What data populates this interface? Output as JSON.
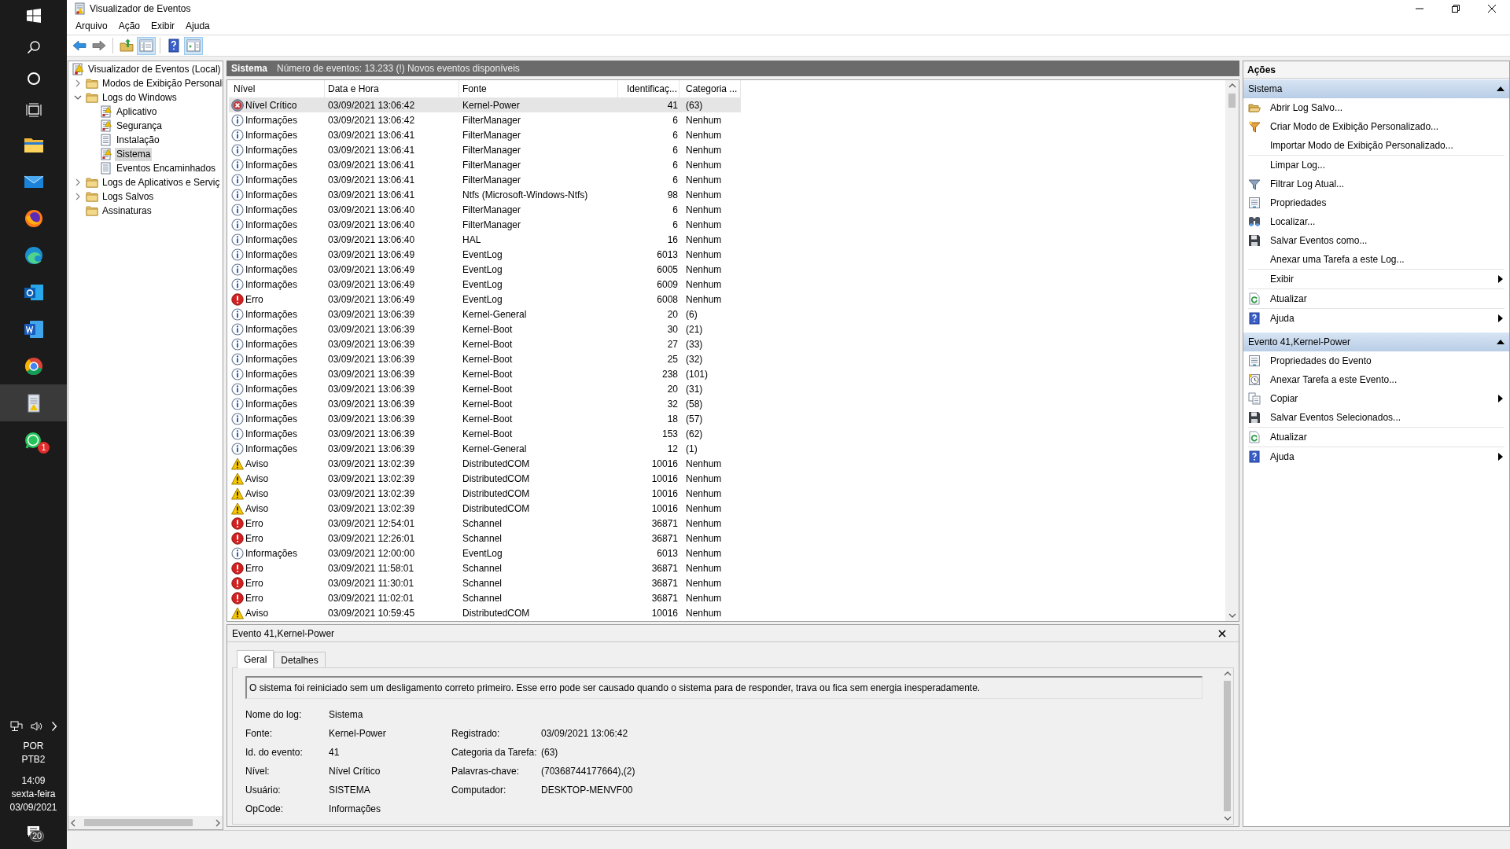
{
  "window": {
    "title": "Visualizador de Eventos"
  },
  "taskbar": {
    "apps": [
      {
        "kind": "folder",
        "selected": false
      },
      {
        "kind": "envelope",
        "selected": false
      },
      {
        "kind": "fox",
        "selected": false
      },
      {
        "kind": "wave",
        "selected": false
      },
      {
        "kind": "envelope-doc",
        "selected": false
      },
      {
        "kind": "doc",
        "selected": false
      },
      {
        "kind": "ring",
        "selected": false
      },
      {
        "kind": "log",
        "selected": true
      },
      {
        "kind": "chat",
        "selected": false,
        "badge": "1"
      }
    ],
    "tray": {
      "language": "POR",
      "layout": "PTB2",
      "time": "14:09",
      "weekday": "sexta-feira",
      "date": "03/09/2021",
      "notifications": "20"
    }
  },
  "menu": [
    "Arquivo",
    "Ação",
    "Exibir",
    "Ajuda"
  ],
  "toolbar": [
    [
      {
        "kind": "back",
        "pressed": false
      },
      {
        "kind": "forward",
        "pressed": false
      }
    ],
    [
      {
        "kind": "up",
        "pressed": false
      },
      {
        "kind": "tree",
        "pressed": true
      }
    ],
    [
      {
        "kind": "help",
        "pressed": false
      },
      {
        "kind": "actions",
        "pressed": true
      }
    ]
  ],
  "tree": [
    {
      "label": "Visualizador de Eventos (Local)",
      "kind": "viewer",
      "selected": false,
      "children": [
        {
          "label": "Modos de Exibição Personali",
          "kind": "folder",
          "selected": false,
          "expanded": false
        },
        {
          "label": "Logs do Windows",
          "kind": "folder",
          "selected": false,
          "expanded": true,
          "children": [
            {
              "label": "Aplicativo",
              "kind": "log-alert",
              "selected": false
            },
            {
              "label": "Segurança",
              "kind": "log-alert",
              "selected": false
            },
            {
              "label": "Instalação",
              "kind": "log",
              "selected": false
            },
            {
              "label": "Sistema",
              "kind": "log-alert",
              "selected": true
            },
            {
              "label": "Eventos Encaminhados",
              "kind": "log",
              "selected": false
            }
          ]
        },
        {
          "label": "Logs de Aplicativos e Serviç",
          "kind": "folder",
          "selected": false,
          "expanded": false
        },
        {
          "label": "Logs Salvos",
          "kind": "folder",
          "selected": false,
          "expanded": false
        },
        {
          "label": "Assinaturas",
          "kind": "folder",
          "selected": false
        }
      ]
    }
  ],
  "log_header": {
    "title": "Sistema",
    "message": "Número de eventos: 13.233 (!) Novos eventos disponíveis"
  },
  "table": {
    "columns": [
      "Nível",
      "Data e Hora",
      "Fonte",
      "Identificaç...",
      "Categoria ..."
    ],
    "rows": [
      {
        "kind": "critical",
        "level": "Nível Crítico",
        "date": "03/09/2021 13:06:42",
        "source": "Kernel-Power",
        "id": "41",
        "category": "(63)",
        "selected": true
      },
      {
        "kind": "info",
        "level": "Informações",
        "date": "03/09/2021 13:06:42",
        "source": "FilterManager",
        "id": "6",
        "category": "Nenhum",
        "selected": false
      },
      {
        "kind": "info",
        "level": "Informações",
        "date": "03/09/2021 13:06:41",
        "source": "FilterManager",
        "id": "6",
        "category": "Nenhum",
        "selected": false
      },
      {
        "kind": "info",
        "level": "Informações",
        "date": "03/09/2021 13:06:41",
        "source": "FilterManager",
        "id": "6",
        "category": "Nenhum",
        "selected": false
      },
      {
        "kind": "info",
        "level": "Informações",
        "date": "03/09/2021 13:06:41",
        "source": "FilterManager",
        "id": "6",
        "category": "Nenhum",
        "selected": false
      },
      {
        "kind": "info",
        "level": "Informações",
        "date": "03/09/2021 13:06:41",
        "source": "FilterManager",
        "id": "6",
        "category": "Nenhum",
        "selected": false
      },
      {
        "kind": "info",
        "level": "Informações",
        "date": "03/09/2021 13:06:41",
        "source": "Ntfs (Microsoft-Windows-Ntfs)",
        "id": "98",
        "category": "Nenhum",
        "selected": false
      },
      {
        "kind": "info",
        "level": "Informações",
        "date": "03/09/2021 13:06:40",
        "source": "FilterManager",
        "id": "6",
        "category": "Nenhum",
        "selected": false
      },
      {
        "kind": "info",
        "level": "Informações",
        "date": "03/09/2021 13:06:40",
        "source": "FilterManager",
        "id": "6",
        "category": "Nenhum",
        "selected": false
      },
      {
        "kind": "info",
        "level": "Informações",
        "date": "03/09/2021 13:06:40",
        "source": "HAL",
        "id": "16",
        "category": "Nenhum",
        "selected": false
      },
      {
        "kind": "info",
        "level": "Informações",
        "date": "03/09/2021 13:06:49",
        "source": "EventLog",
        "id": "6013",
        "category": "Nenhum",
        "selected": false
      },
      {
        "kind": "info",
        "level": "Informações",
        "date": "03/09/2021 13:06:49",
        "source": "EventLog",
        "id": "6005",
        "category": "Nenhum",
        "selected": false
      },
      {
        "kind": "info",
        "level": "Informações",
        "date": "03/09/2021 13:06:49",
        "source": "EventLog",
        "id": "6009",
        "category": "Nenhum",
        "selected": false
      },
      {
        "kind": "error",
        "level": "Erro",
        "date": "03/09/2021 13:06:49",
        "source": "EventLog",
        "id": "6008",
        "category": "Nenhum",
        "selected": false
      },
      {
        "kind": "info",
        "level": "Informações",
        "date": "03/09/2021 13:06:39",
        "source": "Kernel-General",
        "id": "20",
        "category": "(6)",
        "selected": false
      },
      {
        "kind": "info",
        "level": "Informações",
        "date": "03/09/2021 13:06:39",
        "source": "Kernel-Boot",
        "id": "30",
        "category": "(21)",
        "selected": false
      },
      {
        "kind": "info",
        "level": "Informações",
        "date": "03/09/2021 13:06:39",
        "source": "Kernel-Boot",
        "id": "27",
        "category": "(33)",
        "selected": false
      },
      {
        "kind": "info",
        "level": "Informações",
        "date": "03/09/2021 13:06:39",
        "source": "Kernel-Boot",
        "id": "25",
        "category": "(32)",
        "selected": false
      },
      {
        "kind": "info",
        "level": "Informações",
        "date": "03/09/2021 13:06:39",
        "source": "Kernel-Boot",
        "id": "238",
        "category": "(101)",
        "selected": false
      },
      {
        "kind": "info",
        "level": "Informações",
        "date": "03/09/2021 13:06:39",
        "source": "Kernel-Boot",
        "id": "20",
        "category": "(31)",
        "selected": false
      },
      {
        "kind": "info",
        "level": "Informações",
        "date": "03/09/2021 13:06:39",
        "source": "Kernel-Boot",
        "id": "32",
        "category": "(58)",
        "selected": false
      },
      {
        "kind": "info",
        "level": "Informações",
        "date": "03/09/2021 13:06:39",
        "source": "Kernel-Boot",
        "id": "18",
        "category": "(57)",
        "selected": false
      },
      {
        "kind": "info",
        "level": "Informações",
        "date": "03/09/2021 13:06:39",
        "source": "Kernel-Boot",
        "id": "153",
        "category": "(62)",
        "selected": false
      },
      {
        "kind": "info",
        "level": "Informações",
        "date": "03/09/2021 13:06:39",
        "source": "Kernel-General",
        "id": "12",
        "category": "(1)",
        "selected": false
      },
      {
        "kind": "warning",
        "level": "Aviso",
        "date": "03/09/2021 13:02:39",
        "source": "DistributedCOM",
        "id": "10016",
        "category": "Nenhum",
        "selected": false
      },
      {
        "kind": "warning",
        "level": "Aviso",
        "date": "03/09/2021 13:02:39",
        "source": "DistributedCOM",
        "id": "10016",
        "category": "Nenhum",
        "selected": false
      },
      {
        "kind": "warning",
        "level": "Aviso",
        "date": "03/09/2021 13:02:39",
        "source": "DistributedCOM",
        "id": "10016",
        "category": "Nenhum",
        "selected": false
      },
      {
        "kind": "warning",
        "level": "Aviso",
        "date": "03/09/2021 13:02:39",
        "source": "DistributedCOM",
        "id": "10016",
        "category": "Nenhum",
        "selected": false
      },
      {
        "kind": "error",
        "level": "Erro",
        "date": "03/09/2021 12:54:01",
        "source": "Schannel",
        "id": "36871",
        "category": "Nenhum",
        "selected": false
      },
      {
        "kind": "error",
        "level": "Erro",
        "date": "03/09/2021 12:26:01",
        "source": "Schannel",
        "id": "36871",
        "category": "Nenhum",
        "selected": false
      },
      {
        "kind": "info",
        "level": "Informações",
        "date": "03/09/2021 12:00:00",
        "source": "EventLog",
        "id": "6013",
        "category": "Nenhum",
        "selected": false
      },
      {
        "kind": "error",
        "level": "Erro",
        "date": "03/09/2021 11:58:01",
        "source": "Schannel",
        "id": "36871",
        "category": "Nenhum",
        "selected": false
      },
      {
        "kind": "error",
        "level": "Erro",
        "date": "03/09/2021 11:30:01",
        "source": "Schannel",
        "id": "36871",
        "category": "Nenhum",
        "selected": false
      },
      {
        "kind": "error",
        "level": "Erro",
        "date": "03/09/2021 11:02:01",
        "source": "Schannel",
        "id": "36871",
        "category": "Nenhum",
        "selected": false
      },
      {
        "kind": "warning",
        "level": "Aviso",
        "date": "03/09/2021 10:59:45",
        "source": "DistributedCOM",
        "id": "10016",
        "category": "Nenhum",
        "selected": false
      }
    ]
  },
  "details": {
    "title": "Evento 41,Kernel-Power",
    "tabs": [
      {
        "label": "Geral",
        "selected": true
      },
      {
        "label": "Detalhes",
        "selected": false
      }
    ],
    "description": "O sistema foi reiniciado sem um desligamento correto primeiro. Esse erro pode ser causado quando o sistema para de responder, trava ou fica sem energia inesperadamente.",
    "left_fields": [
      {
        "label": "Nome do log:",
        "value": "Sistema"
      },
      {
        "label": "Fonte:",
        "value": "Kernel-Power"
      },
      {
        "label": "Id. do evento:",
        "value": "41"
      },
      {
        "label": "Nível:",
        "value": "Nível Crítico"
      },
      {
        "label": "Usuário:",
        "value": "SISTEMA"
      },
      {
        "label": "OpCode:",
        "value": "Informações"
      }
    ],
    "right_fields": [
      {
        "label": "Registrado:",
        "value": "03/09/2021 13:06:42"
      },
      {
        "label": "Categoria da Tarefa:",
        "value": "(63)"
      },
      {
        "label": "Palavras-chave:",
        "value": "(70368744177664),(2)"
      },
      {
        "label": "Computador:",
        "value": "DESKTOP-MENVF00"
      }
    ]
  },
  "actions": {
    "title": "Ações",
    "sections": [
      {
        "title": "Sistema",
        "expanded": true,
        "groups": [
          [
            {
              "label": "Abrir Log Salvo...",
              "kind": "open",
              "submenu": false
            },
            {
              "label": "Criar Modo de Exibição Personalizado...",
              "kind": "filter-new",
              "submenu": false
            },
            {
              "label": "Importar Modo de Exibição Personalizado...",
              "submenu": false
            }
          ],
          [
            {
              "label": "Limpar Log...",
              "submenu": false
            },
            {
              "label": "Filtrar Log Atual...",
              "kind": "filter",
              "submenu": false
            },
            {
              "label": "Propriedades",
              "kind": "properties",
              "submenu": false
            },
            {
              "label": "Localizar...",
              "kind": "find",
              "submenu": false
            },
            {
              "label": "Salvar Eventos como...",
              "kind": "save",
              "submenu": false
            },
            {
              "label": "Anexar uma Tarefa a este Log...",
              "submenu": false
            }
          ],
          [
            {
              "label": "Exibir",
              "submenu": true
            }
          ],
          [
            {
              "label": "Atualizar",
              "kind": "refresh",
              "submenu": false
            }
          ],
          [
            {
              "label": "Ajuda",
              "kind": "help",
              "submenu": true
            }
          ]
        ]
      },
      {
        "title": "Evento 41,Kernel-Power",
        "expanded": true,
        "groups": [
          [
            {
              "label": "Propriedades do Evento",
              "kind": "properties",
              "submenu": false
            },
            {
              "label": "Anexar Tarefa a este Evento...",
              "kind": "task",
              "submenu": false
            },
            {
              "label": "Copiar",
              "kind": "copy",
              "submenu": true
            },
            {
              "label": "Salvar Eventos Selecionados...",
              "kind": "save",
              "submenu": false
            }
          ],
          [
            {
              "label": "Atualizar",
              "kind": "refresh",
              "submenu": false
            }
          ],
          [
            {
              "label": "Ajuda",
              "kind": "help",
              "submenu": true
            }
          ]
        ]
      }
    ]
  }
}
